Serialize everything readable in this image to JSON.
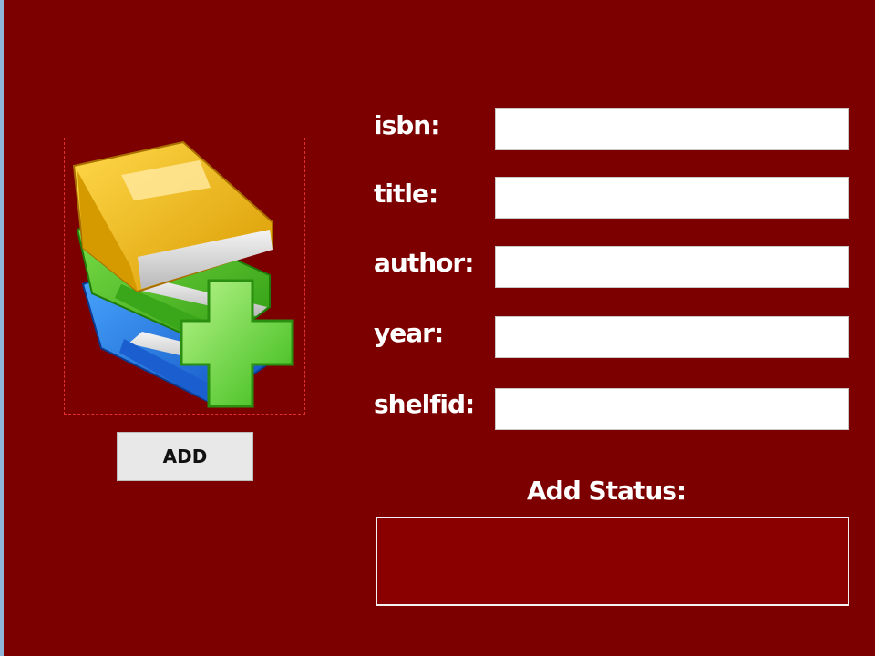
{
  "form": {
    "fields": [
      {
        "label": "isbn:",
        "value": ""
      },
      {
        "label": "title:",
        "value": ""
      },
      {
        "label": "author:",
        "value": ""
      },
      {
        "label": "year:",
        "value": ""
      },
      {
        "label": "shelfid:",
        "value": ""
      }
    ],
    "add_label": "ADD",
    "status_label": "Add Status:",
    "status_value": ""
  },
  "icon": {
    "name": "add-book-icon"
  },
  "colors": {
    "background": "#7d0000",
    "status_box": "#8a0000",
    "text": "#ffffff"
  }
}
